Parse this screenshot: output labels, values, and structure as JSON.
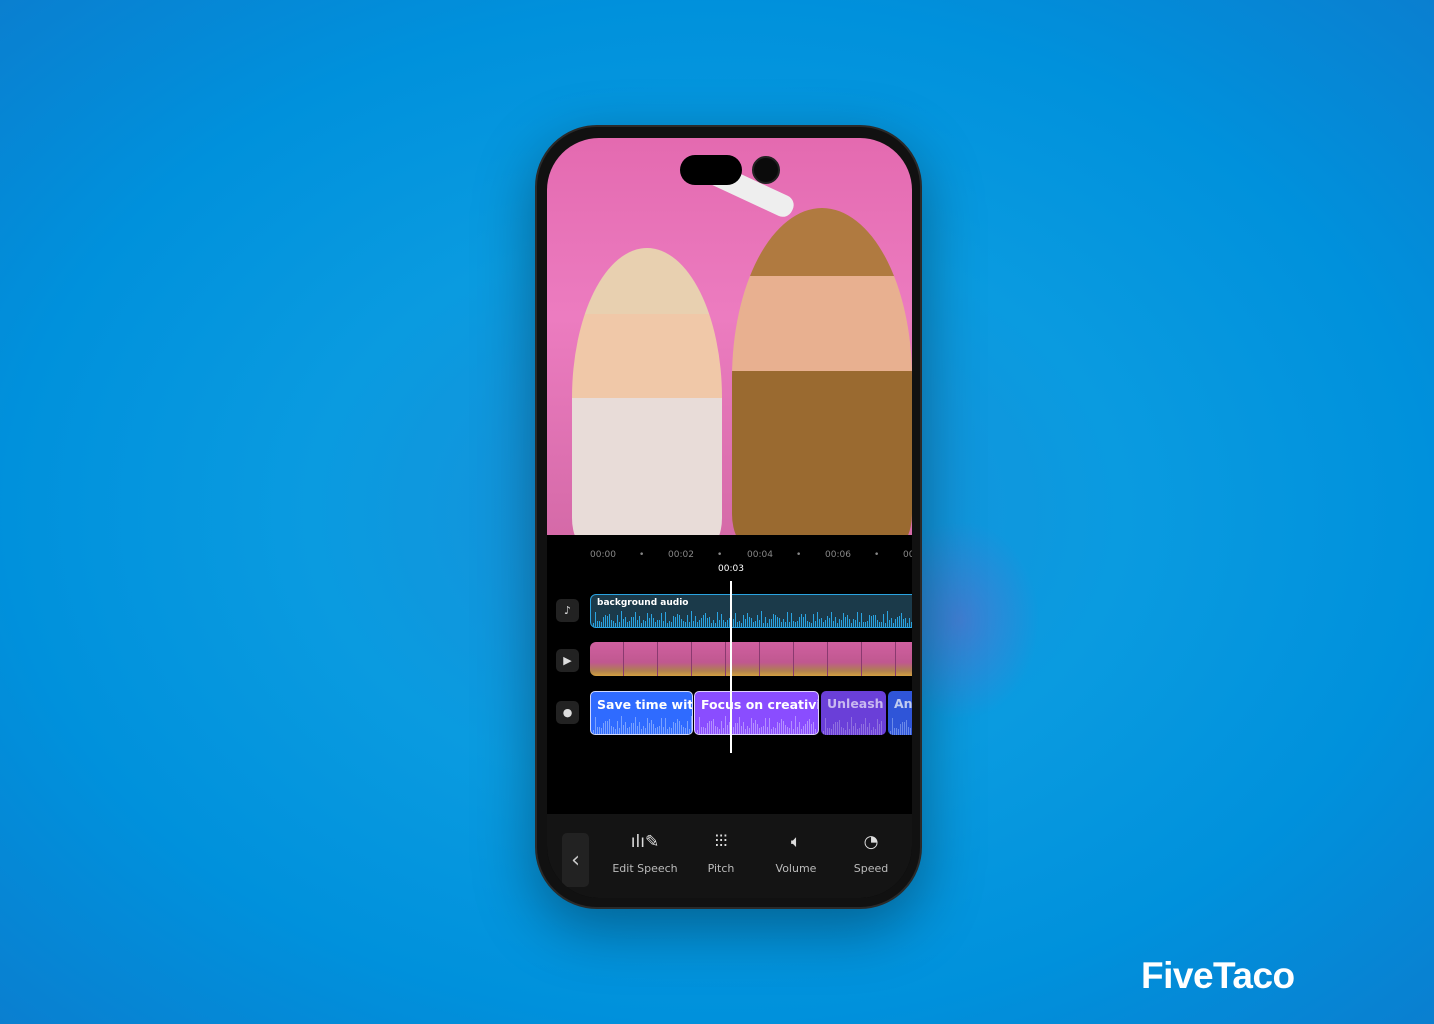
{
  "timeline": {
    "ruler": [
      "00:00",
      "00:02",
      "00:04",
      "00:06",
      "00"
    ],
    "current_time": "00:03",
    "audio_track": {
      "label": "background audio"
    },
    "captions": [
      {
        "text": "Save time with",
        "color": "#2f6bff"
      },
      {
        "text": "Focus on creativity",
        "color": "#8a4dff"
      },
      {
        "text": "Unleash y",
        "color": "#6a3fd8"
      },
      {
        "text": "An",
        "color": "#2f55d8"
      }
    ]
  },
  "track_icons": [
    "music-note-icon",
    "video-icon",
    "voice-icon"
  ],
  "toolbar": {
    "back": "‹",
    "tools": [
      {
        "label": "Edit Speech",
        "icon": "edit-speech-icon"
      },
      {
        "label": "Pitch",
        "icon": "sliders-icon"
      },
      {
        "label": "Volume",
        "icon": "speaker-icon"
      },
      {
        "label": "Speed",
        "icon": "speedometer-icon"
      }
    ]
  },
  "brand": "FiveTaco",
  "colors": {
    "audio": "#2aa3e0",
    "background": "#0091dc"
  }
}
